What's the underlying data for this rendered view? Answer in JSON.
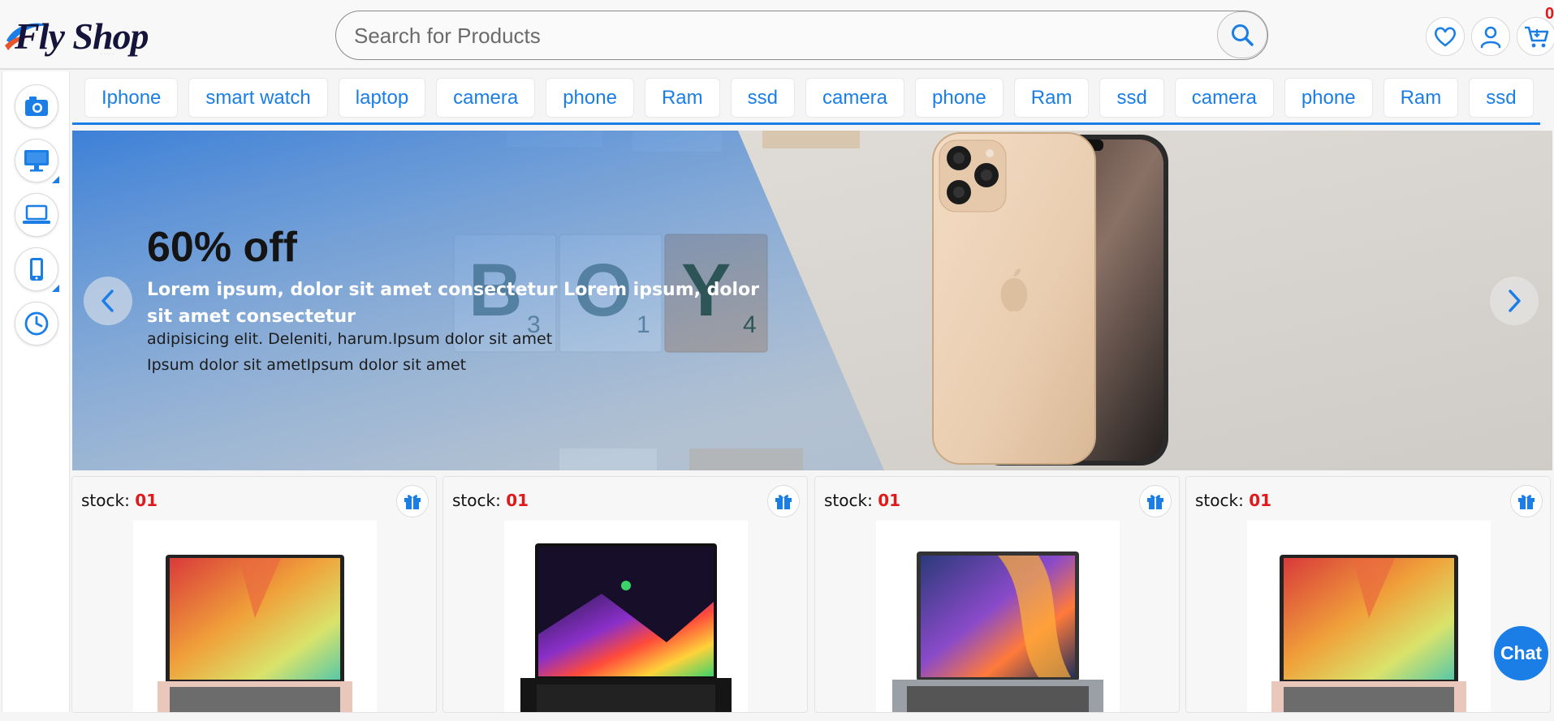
{
  "header": {
    "logo_text": "Fly Shop",
    "search_placeholder": "Search for Products",
    "icons": [
      "search-icon",
      "heart-icon",
      "user-icon",
      "cart-icon"
    ],
    "cart_count": "0"
  },
  "rail": {
    "items": [
      "camera-icon",
      "desktop-icon",
      "laptop-icon",
      "phone-icon",
      "clock-icon"
    ]
  },
  "categories": [
    "Iphone",
    "smart watch",
    "laptop",
    "camera",
    "phone",
    "Ram",
    "ssd",
    "camera",
    "phone",
    "Ram",
    "ssd",
    "camera",
    "phone",
    "Ram",
    "ssd"
  ],
  "banner": {
    "title": "60% off",
    "subtitle": "Lorem ipsum, dolor sit amet consectetur Lorem ipsum, dolor sit amet consectetur",
    "line1": "adipisicing elit. Deleniti, harum.Ipsum dolor sit amet",
    "line2": "Ipsum dolor sit ametIpsum dolor sit amet",
    "tiles": [
      "B",
      "O",
      "Y"
    ],
    "tile_numbers": [
      "3",
      "1",
      "4"
    ]
  },
  "products": [
    {
      "stock_label": "stock:",
      "stock_value": "01",
      "image": "laptop-asus-vivobook"
    },
    {
      "stock_label": "stock:",
      "stock_value": "01",
      "image": "laptop-razer"
    },
    {
      "stock_label": "stock:",
      "stock_value": "01",
      "image": "laptop-xiaomi"
    },
    {
      "stock_label": "stock:",
      "stock_value": "01",
      "image": "laptop-asus-vivobook"
    }
  ],
  "chat_label": "Chat",
  "colors": {
    "accent": "#1a7ee6",
    "stock_red": "#e0191b"
  }
}
